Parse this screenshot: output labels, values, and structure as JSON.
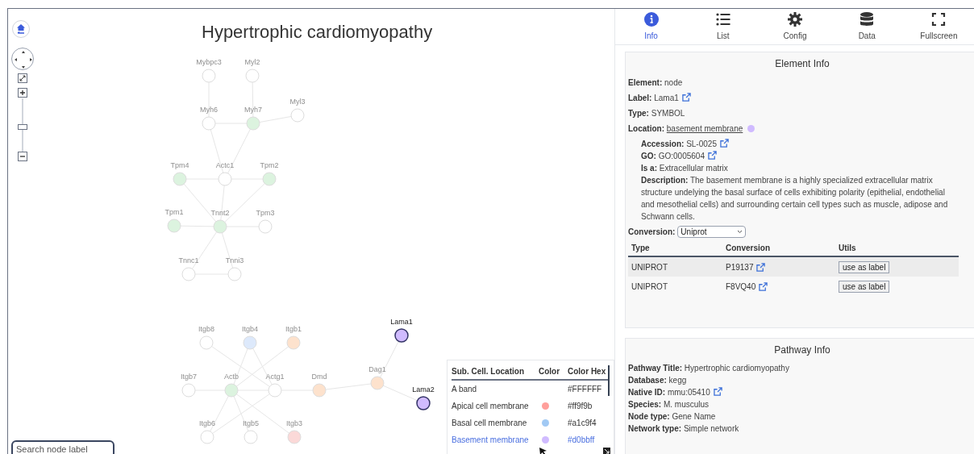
{
  "graph": {
    "title": "Hypertrophic cardiomyopathy",
    "nodes": [
      {
        "label": "Mybpc3",
        "color": "#ffffff",
        "highlighted": false
      },
      {
        "label": "Myl2",
        "color": "#ffffff",
        "highlighted": false
      },
      {
        "label": "Myh6",
        "color": "#ffffff",
        "highlighted": false
      },
      {
        "label": "Myh7",
        "color": "#dcf3df",
        "highlighted": false
      },
      {
        "label": "Myl3",
        "color": "#ffffff",
        "highlighted": false
      },
      {
        "label": "Tpm4",
        "color": "#dcf3df",
        "highlighted": false
      },
      {
        "label": "Actc1",
        "color": "#ffffff",
        "highlighted": false
      },
      {
        "label": "Tpm2",
        "color": "#dcf3df",
        "highlighted": false
      },
      {
        "label": "Tpm1",
        "color": "#dcf3df",
        "highlighted": false
      },
      {
        "label": "Tnnt2",
        "color": "#dcf3df",
        "highlighted": false
      },
      {
        "label": "Tpm3",
        "color": "#ffffff",
        "highlighted": false
      },
      {
        "label": "Tnnc1",
        "color": "#ffffff",
        "highlighted": false
      },
      {
        "label": "Tnni3",
        "color": "#ffffff",
        "highlighted": false
      },
      {
        "label": "Itgb8",
        "color": "#ffffff",
        "highlighted": false
      },
      {
        "label": "Itgb4",
        "color": "#dde9fb",
        "highlighted": false
      },
      {
        "label": "Itgb1",
        "color": "#fde2cd",
        "highlighted": false
      },
      {
        "label": "Lama1",
        "color": "#d0bbff",
        "highlighted": true
      },
      {
        "label": "Itgb7",
        "color": "#ffffff",
        "highlighted": false
      },
      {
        "label": "Actb",
        "color": "#dcf3df",
        "highlighted": false
      },
      {
        "label": "Actg1",
        "color": "#ffffff",
        "highlighted": false
      },
      {
        "label": "Dmd",
        "color": "#fde2cd",
        "highlighted": false
      },
      {
        "label": "Dag1",
        "color": "#fde2cd",
        "highlighted": false
      },
      {
        "label": "Lama2",
        "color": "#d0bbff",
        "highlighted": true
      },
      {
        "label": "Itgb6",
        "color": "#ffffff",
        "highlighted": false
      },
      {
        "label": "Itgb5",
        "color": "#ffffff",
        "highlighted": false
      },
      {
        "label": "Itgb3",
        "color": "#fbd9d8",
        "highlighted": false
      }
    ],
    "search": {
      "placeholder": "Search node label"
    },
    "legend": {
      "columns": [
        "Sub. Cell. Location",
        "Color",
        "Color Hex"
      ],
      "rows": [
        {
          "location": "A band",
          "hex": "#FFFFFF",
          "selected": false
        },
        {
          "location": "Apical cell membrane",
          "color": "#ff9f9b",
          "hex": "#ff9f9b",
          "selected": false
        },
        {
          "location": "Basal cell membrane",
          "color": "#a1c9f4",
          "hex": "#a1c9f4",
          "selected": false
        },
        {
          "location": "Basement membrane",
          "color": "#d0bbff",
          "hex": "#d0bbff",
          "selected": true
        }
      ]
    }
  },
  "tabs": [
    {
      "label": "Info",
      "kind": "info",
      "selected": true
    },
    {
      "label": "List",
      "kind": "list",
      "selected": false
    },
    {
      "label": "Config",
      "kind": "config",
      "selected": false
    },
    {
      "label": "Data",
      "kind": "data",
      "selected": false
    },
    {
      "label": "Fullscreen",
      "kind": "fullscreen",
      "selected": false
    }
  ],
  "element_info": {
    "title": "Element Info",
    "fields": [
      {
        "label": "Element:",
        "value": "node",
        "kind": "text"
      },
      {
        "label": "Label:",
        "value": "Lama1",
        "kind": "external"
      },
      {
        "label": "Type:",
        "value": "SYMBOL",
        "kind": "text"
      },
      {
        "label": "Location:",
        "value": "basement membrane",
        "kind": "link",
        "color": "#d0bbff"
      }
    ],
    "location_details": [
      {
        "label": "Accession:",
        "value": "SL-0025",
        "kind": "external"
      },
      {
        "label": "GO:",
        "value": "GO:0005604",
        "kind": "external"
      },
      {
        "label": "Is a:",
        "value": "Extracellular matrix",
        "kind": "text"
      },
      {
        "label": "Description:",
        "value": "The basement membrane is a highly specialized extracellular matrix structure undelying the basal surface of cells exhibiting polarity (epithelial, endothelial and mesothelial cells) and surrounding certain cell types such as muscle, adipose and Schwann cells.",
        "kind": "text"
      }
    ],
    "conversion": {
      "label": "Conversion:",
      "value": "Uniprot"
    },
    "table": {
      "columns": [
        "Type",
        "Conversion",
        "Utils"
      ],
      "rows": [
        {
          "type": "UNIPROT",
          "conversion": "P19137",
          "button": "use as label"
        },
        {
          "type": "UNIPROT",
          "conversion": "F8VQ40",
          "button": "use as label"
        }
      ]
    }
  },
  "pathway_info": {
    "title": "Pathway Info",
    "fields": [
      {
        "label": "Pathway Title:",
        "value": "Hypertrophic cardiomyopathy",
        "kind": "text"
      },
      {
        "label": "Database:",
        "value": "kegg",
        "kind": "text"
      },
      {
        "label": "Native ID:",
        "value": "mmu:05410",
        "kind": "external"
      },
      {
        "label": "Species:",
        "value": "M. musculus",
        "kind": "text"
      },
      {
        "label": "Node type:",
        "value": "Gene Name",
        "kind": "text"
      },
      {
        "label": "Network type:",
        "value": "Simple network",
        "kind": "text"
      }
    ]
  }
}
